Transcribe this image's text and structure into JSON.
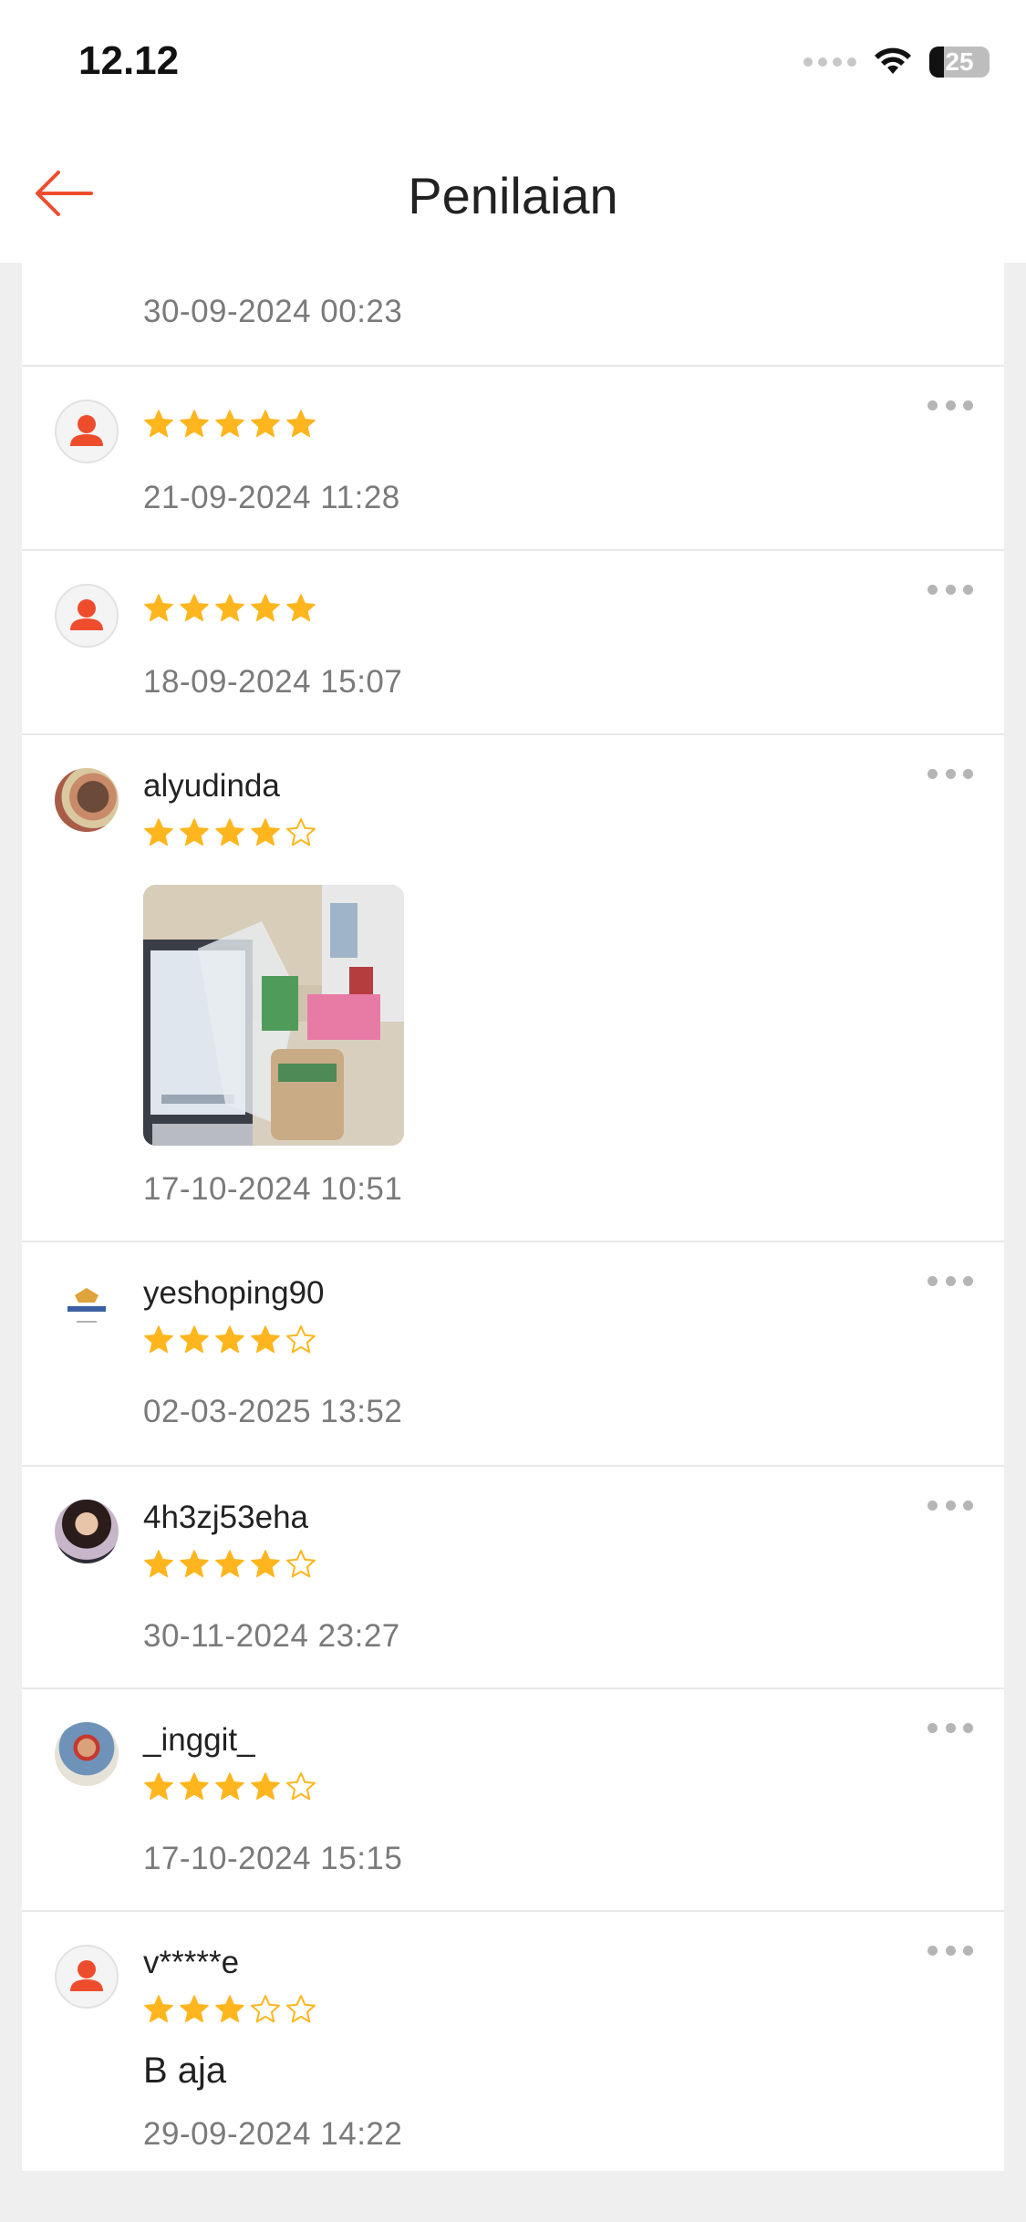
{
  "status_bar": {
    "time": "12.12",
    "battery": "25"
  },
  "header": {
    "title": "Penilaian"
  },
  "colors": {
    "accent": "#ee4d2d",
    "star": "#ffb61e",
    "star_empty": "#ffb61e"
  },
  "reviews": [
    {
      "username": "",
      "rating": 5,
      "date": "30-09-2024 00:23",
      "comment": "",
      "avatar": "default-avatar-icon"
    },
    {
      "username": "",
      "rating": 5,
      "date": "21-09-2024 11:28",
      "comment": "",
      "avatar": "default-avatar-icon"
    },
    {
      "username": "",
      "rating": 5,
      "date": "18-09-2024 15:07",
      "comment": "",
      "avatar": "default-avatar-icon"
    },
    {
      "username": "alyudinda",
      "rating": 4,
      "date": "17-10-2024 10:51",
      "comment": "",
      "avatar": "user-photo",
      "has_photo": true
    },
    {
      "username": "yeshoping90",
      "rating": 4,
      "date": "02-03-2025 13:52",
      "comment": "",
      "avatar": "shop-logo"
    },
    {
      "username": "4h3zj53eha",
      "rating": 4,
      "date": "30-11-2024 23:27",
      "comment": "",
      "avatar": "user-photo"
    },
    {
      "username": "_inggit_",
      "rating": 4,
      "date": "17-10-2024 15:15",
      "comment": "",
      "avatar": "user-photo"
    },
    {
      "username": "v*****e",
      "rating": 3,
      "date": "29-09-2024 14:22",
      "comment": "B aja",
      "avatar": "default-avatar-icon"
    }
  ]
}
